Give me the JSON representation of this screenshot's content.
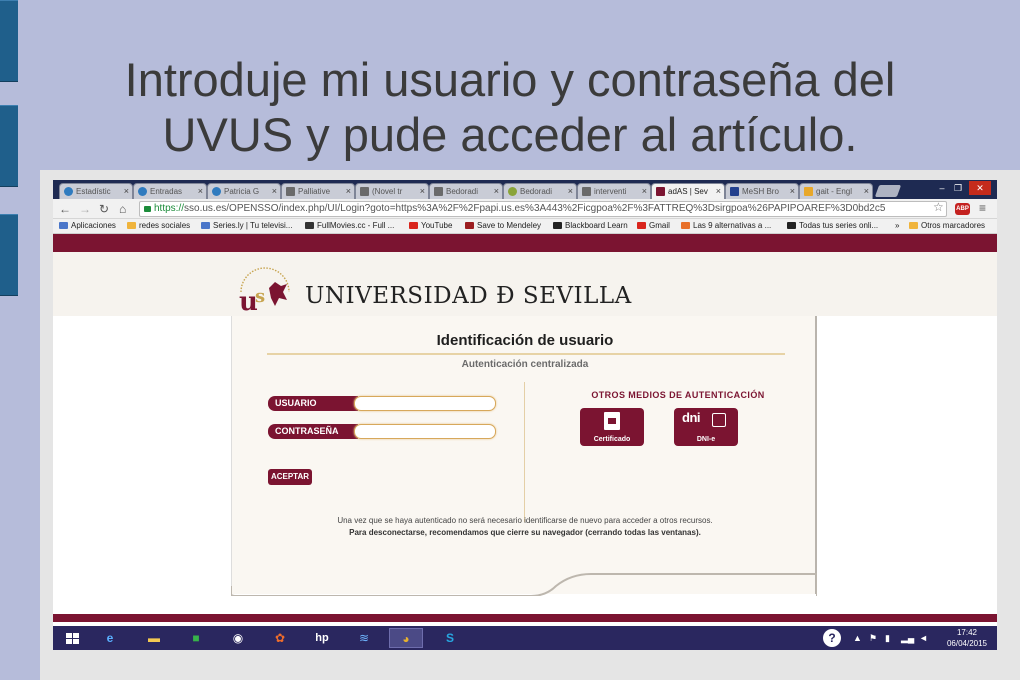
{
  "slide": {
    "title": "Introduje mi usuario y contraseña del\nUVUS y pude acceder al artículo."
  },
  "browser": {
    "tabs": [
      {
        "label": "Estadístic",
        "icon": "wordpress-icon"
      },
      {
        "label": "Entradas",
        "icon": "wordpress-icon"
      },
      {
        "label": "Patricia G",
        "icon": "wordpress-icon"
      },
      {
        "label": "Palliative",
        "icon": "document-icon"
      },
      {
        "label": "(Novel tr",
        "icon": "document-icon"
      },
      {
        "label": "Bedoradi",
        "icon": "document-icon"
      },
      {
        "label": "Bedoradi",
        "icon": "leaf-icon"
      },
      {
        "label": "interventi",
        "icon": "document-icon"
      },
      {
        "label": "adAS | Sev",
        "icon": "university-icon"
      },
      {
        "label": "MeSH Bro",
        "icon": "mesh-icon"
      },
      {
        "label": "gait - Engl",
        "icon": "wordreference-icon"
      }
    ],
    "url_secure": "https://",
    "url_host": "sso.us.es",
    "url_rest": "/OPENSSO/index.php/UI/Login?goto=https%3A%2F%2Fpapi.us.es%3A443%2Ficgpoa%2F%3FATTREQ%3Dsirgpoa%26PAPIPOAREF%3D0bd2c5",
    "abp_label": "ABP",
    "bookmarks": [
      {
        "label": "Aplicaciones",
        "color": "#4a76c9"
      },
      {
        "label": "redes sociales",
        "color": "#f0b43c"
      },
      {
        "label": "Series.ly | Tu televisi...",
        "color": "#4a76c9"
      },
      {
        "label": "FullMovies.cc - Full ...",
        "color": "#333333"
      },
      {
        "label": "YouTube",
        "color": "#d9251d"
      },
      {
        "label": "Save to Mendeley",
        "color": "#9b1d20"
      },
      {
        "label": "Blackboard Learn",
        "color": "#222222"
      },
      {
        "label": "Gmail",
        "color": "#d9251d"
      },
      {
        "label": "Las 9 alternativas a ...",
        "color": "#e8702a"
      },
      {
        "label": "Todas tus series onli...",
        "color": "#222222"
      },
      {
        "label": "Otros marcadores",
        "color": "#f0b43c"
      }
    ],
    "more_bookmarks": "»"
  },
  "page": {
    "university_name": "UNIVERSIDAD Ð SEVILLA",
    "card_title": "Identificación de usuario",
    "card_subtitle": "Autenticación centralizada",
    "user_label": "USUARIO",
    "user_value": "",
    "password_label": "CONTRASEÑA",
    "password_value": "",
    "accept_label": "ACEPTAR",
    "other_title": "OTROS MEDIOS DE AUTENTICACIÓN",
    "cert_label": "Certificado",
    "dni_logo": "dni",
    "dni_label": "DNI-e",
    "info_line1": "Una vez que se haya autenticado no será necesario identificarse de nuevo para acceder a otros recursos.",
    "info_line2": "Para desconectarse, recomendamos que cierre su navegador (cerrando todas las ventanas)."
  },
  "taskbar": {
    "time": "17:42",
    "date": "06/04/2015"
  },
  "colors": {
    "brand": "#7b1431",
    "slide_bg": "#b6bcda",
    "taskbar": "#2a275f"
  }
}
